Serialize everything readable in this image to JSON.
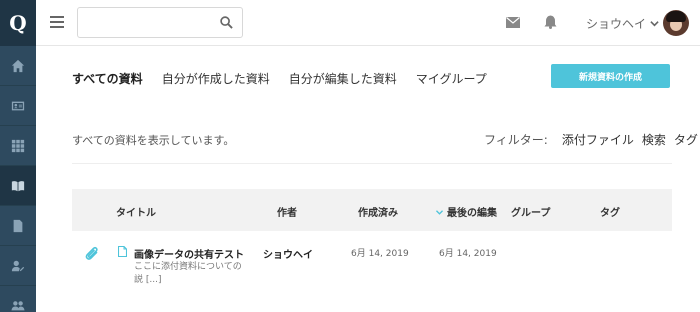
{
  "app": {
    "logo": "Q"
  },
  "sidebar": {
    "items": [
      {
        "icon": "home-icon"
      },
      {
        "icon": "id-card-icon"
      },
      {
        "icon": "grid-icon"
      },
      {
        "icon": "book-icon",
        "active": true
      },
      {
        "icon": "document-icon"
      },
      {
        "icon": "user-edit-icon"
      },
      {
        "icon": "users-icon"
      }
    ]
  },
  "header": {
    "search": {
      "value": "",
      "placeholder": ""
    },
    "user": {
      "name": "ショウヘイ"
    }
  },
  "tabs": [
    {
      "label": "すべての資料",
      "active": true
    },
    {
      "label": "自分が作成した資料"
    },
    {
      "label": "自分が編集した資料"
    },
    {
      "label": "マイグループ"
    }
  ],
  "actions": {
    "new_label": "新規資料の作成"
  },
  "info_text": "すべての資料を表示しています。",
  "filter": {
    "label": "フィルター:",
    "options": [
      "添付ファイル",
      "検索",
      "タグ"
    ]
  },
  "table": {
    "columns": {
      "title": "タイトル",
      "author": "作者",
      "created": "作成済み",
      "edited": "最後の編集",
      "group": "グループ",
      "tag": "タグ"
    },
    "rows": [
      {
        "title": "画像データの共有テスト",
        "description": "ここに添付資料についての説 [...]",
        "author": "ショウヘイ",
        "created": "6月 14, 2019",
        "edited": "6月 14, 2019",
        "group": "",
        "tag": ""
      }
    ]
  },
  "colors": {
    "sidebar": "#2e4a5f",
    "accent": "#4ec4da",
    "header_row": "#f2f2f2"
  }
}
